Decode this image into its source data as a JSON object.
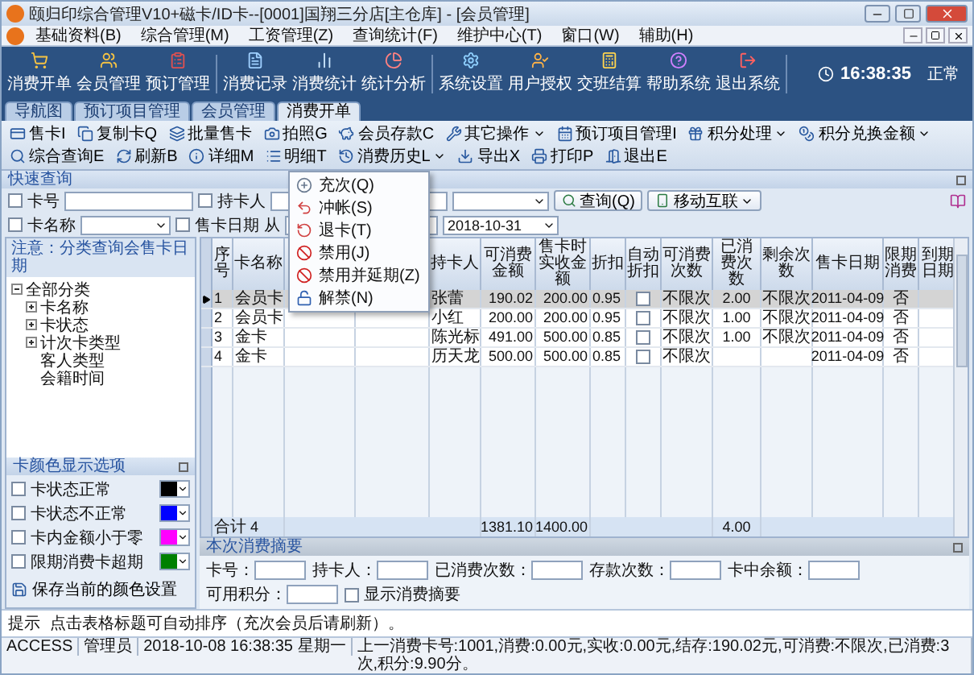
{
  "window": {
    "title": "颐归印综合管理V10+磁卡/ID卡--[0001]国翔三分店[主仓库] - [会员管理]"
  },
  "menu_bar": [
    {
      "label": "基础资料(B)"
    },
    {
      "label": "综合管理(M)"
    },
    {
      "label": "工资管理(Z)"
    },
    {
      "label": "查询统计(F)"
    },
    {
      "label": "维护中心(T)"
    },
    {
      "label": "窗口(W)"
    },
    {
      "label": "辅助(H)"
    }
  ],
  "main_toolbar": {
    "buttons": [
      {
        "label": "消费开单"
      },
      {
        "label": "会员管理"
      },
      {
        "label": "预订管理"
      },
      {
        "label": "消费记录"
      },
      {
        "label": "消费统计"
      },
      {
        "label": "统计分析"
      },
      {
        "label": "系统设置"
      },
      {
        "label": "用户授权"
      },
      {
        "label": "交班结算"
      },
      {
        "label": "帮助系统"
      },
      {
        "label": "退出系统"
      }
    ],
    "clock": "16:38:35",
    "status": "正常"
  },
  "tabs": [
    {
      "label": "导航图",
      "selected": false
    },
    {
      "label": "预订项目管理",
      "selected": false
    },
    {
      "label": "会员管理",
      "selected": false
    },
    {
      "label": "消费开单",
      "selected": true
    }
  ],
  "toolbar": [
    {
      "label": "售卡I",
      "dropdown": false
    },
    {
      "label": "复制卡Q",
      "dropdown": false
    },
    {
      "label": "批量售卡",
      "dropdown": false
    },
    {
      "label": "拍照G",
      "dropdown": false
    },
    {
      "label": "会员存款C",
      "dropdown": false
    },
    {
      "label": "其它操作",
      "dropdown": true
    },
    {
      "label": "预订项目管理I",
      "dropdown": false
    },
    {
      "label": "积分处理",
      "dropdown": true
    },
    {
      "label": "积分兑换金额",
      "dropdown": true
    },
    {
      "label": "综合查询E",
      "dropdown": false
    },
    {
      "label": "刷新B",
      "dropdown": false
    },
    {
      "label": "详细M",
      "dropdown": false
    },
    {
      "label": "明细T",
      "dropdown": false
    },
    {
      "label": "消费历史L",
      "dropdown": true
    },
    {
      "label": "导出X",
      "dropdown": false
    },
    {
      "label": "打印P",
      "dropdown": false
    },
    {
      "label": "退出E",
      "dropdown": false
    }
  ],
  "popup_menu": [
    {
      "label": "充次(Q)"
    },
    {
      "label": "冲帐(S)"
    },
    {
      "label": "退卡(T)"
    },
    {
      "label": "禁用(J)"
    },
    {
      "label": "禁用并延期(Z)"
    },
    {
      "label": "解禁(N)"
    }
  ],
  "quick_search": {
    "title": "快速查询",
    "card_no": {
      "label": "卡号",
      "checked": false
    },
    "holder": {
      "label": "持卡人",
      "checked": false
    },
    "query_button": "查询(Q)",
    "mobile_button": "移动互联",
    "card_name": {
      "label": "卡名称",
      "checked": false
    },
    "sale_date": {
      "label": "售卡日期",
      "checked": false
    },
    "from_label": "从",
    "date_to": "2018-10-31"
  },
  "left_panel": {
    "note": "注意：分类查询会售卡日期",
    "tree": [
      {
        "label": "全部分类",
        "expanded": true,
        "children": [
          {
            "label": "卡名称",
            "expanded": false
          },
          {
            "label": "卡状态",
            "expanded": false
          },
          {
            "label": "计次卡类型",
            "expanded": false
          },
          {
            "label": "客人类型"
          },
          {
            "label": "会籍时间"
          }
        ]
      }
    ]
  },
  "color_options": {
    "title": "卡颜色显示选项",
    "items": [
      {
        "label": "卡状态正常",
        "checked": false,
        "color": "#000000"
      },
      {
        "label": "卡状态不正常",
        "checked": false,
        "color": "#0000ff"
      },
      {
        "label": "卡内金额小于零",
        "checked": false,
        "color": "#ff00ff"
      },
      {
        "label": "限期消费卡超期",
        "checked": false,
        "color": "#008000"
      }
    ],
    "save_button": "保存当前的颜色设置"
  },
  "grid": {
    "columns": [
      {
        "label": "序号",
        "covered": false
      },
      {
        "label": "卡名称",
        "covered": false
      },
      {
        "covered": true
      },
      {
        "covered": true
      },
      {
        "label": "持卡人",
        "covered": false
      },
      {
        "label": "可消费金额",
        "covered": false
      },
      {
        "label": "售卡时实收金额",
        "covered": false
      },
      {
        "label": "折扣",
        "covered": false
      },
      {
        "label": "自动折扣",
        "covered": false
      },
      {
        "label": "可消费次数",
        "covered": false
      },
      {
        "label": "已消费次数",
        "covered": false
      },
      {
        "label": "剩余次数",
        "covered": false
      },
      {
        "label": "售卡日期",
        "covered": false
      },
      {
        "label": "限期消费",
        "covered": false
      },
      {
        "label": "到期日期",
        "covered": false
      }
    ],
    "rows": [
      {
        "selected": true,
        "no": "1",
        "card_name": "会员卡",
        "holder": "张蕾",
        "balance": "190.02",
        "paid": "200.00",
        "discount": "0.95",
        "auto_discount": false,
        "allowed_times": "不限次",
        "used_times": "2.00",
        "remaining_times": "不限次",
        "sale_date": "2011-04-09",
        "time_limited": "否"
      },
      {
        "selected": false,
        "no": "2",
        "card_name": "会员卡",
        "holder": "小红",
        "balance": "200.00",
        "paid": "200.00",
        "discount": "0.95",
        "auto_discount": false,
        "allowed_times": "不限次",
        "used_times": "1.00",
        "remaining_times": "不限次",
        "sale_date": "2011-04-09",
        "time_limited": "否"
      },
      {
        "selected": false,
        "no": "3",
        "card_name": "金卡",
        "holder": "陈光标",
        "balance": "491.00",
        "paid": "500.00",
        "discount": "0.85",
        "auto_discount": false,
        "allowed_times": "不限次",
        "used_times": "1.00",
        "remaining_times": "不限次",
        "sale_date": "2011-04-09",
        "time_limited": "否"
      },
      {
        "selected": false,
        "no": "4",
        "card_name": "金卡",
        "holder": "历天龙",
        "balance": "500.00",
        "paid": "500.00",
        "discount": "0.85",
        "auto_discount": false,
        "allowed_times": "不限次",
        "sale_date": "2011-04-09",
        "time_limited": "否"
      }
    ],
    "total": {
      "label": "合计",
      "count": "4",
      "balance": "1381.10",
      "paid": "1400.00",
      "used_times": "4.00"
    }
  },
  "summary": {
    "title": "本次消费摘要",
    "fields": [
      {
        "label": "卡号："
      },
      {
        "label": "持卡人："
      },
      {
        "label": "已消费次数："
      },
      {
        "label": "存款次数："
      },
      {
        "label": "卡中余额："
      },
      {
        "label": "可用积分："
      }
    ],
    "show_summary": {
      "label": "显示消费摘要",
      "checked": false
    }
  },
  "hint": {
    "label": "提示",
    "text": "点击表格标题可自动排序（充次会员后请刷新）。"
  },
  "status_bar": [
    "ACCESS",
    "管理员",
    "2018-10-08 16:38:35 星期一",
    "上一消费卡号:1001,消费:0.00元,实收:0.00元,结存:190.02元,可消费:不限次,已消费:3次,积分:9.90分。"
  ]
}
